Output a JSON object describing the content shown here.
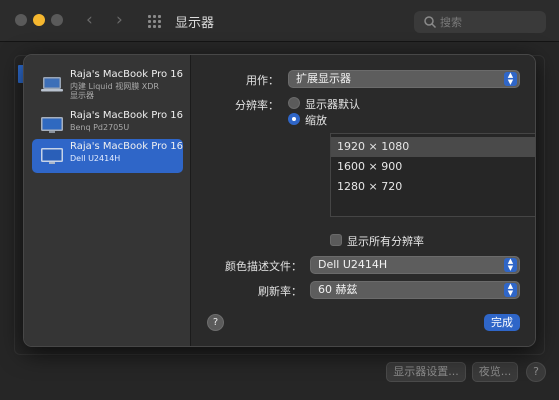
{
  "window": {
    "title": "显示器",
    "search_placeholder": "搜索",
    "buttons": {
      "display_settings": "显示器设置...",
      "night_shift": "夜览...",
      "help": "?"
    }
  },
  "sidebar": {
    "items": [
      {
        "name": "Raja's MacBook Pro 16",
        "subtitle_line1": "内建 Liquid 视网膜 XDR",
        "subtitle_line2": "显示器",
        "icon": "laptop-icon",
        "selected": false
      },
      {
        "name": "Raja's MacBook Pro 16",
        "subtitle_line1": "Benq Pd2705U",
        "subtitle_line2": "",
        "icon": "monitor-icon",
        "selected": false
      },
      {
        "name": "Raja's MacBook Pro 16",
        "subtitle_line1": "Dell U2414H",
        "subtitle_line2": "",
        "icon": "monitor-icon",
        "selected": true
      }
    ]
  },
  "settings": {
    "use_as_label": "用作：",
    "use_as_value": "扩展显示器",
    "resolution_label": "分辨率：",
    "radio_default": "显示器默认",
    "radio_scaled": "缩放",
    "resolutions": [
      "1920 × 1080",
      "1600 × 900",
      "1280 × 720"
    ],
    "selected_resolution": "1920 × 1080",
    "show_all_label": "显示所有分辨率",
    "color_profile_label": "颜色描述文件：",
    "color_profile_value": "Dell U2414H",
    "refresh_label": "刷新率：",
    "refresh_value": "60 赫兹",
    "help": "?",
    "done_label": "完成"
  },
  "colors": {
    "accent": "#2f66c8",
    "minimize": "#f5b72f",
    "background": "#1e1e1e"
  }
}
